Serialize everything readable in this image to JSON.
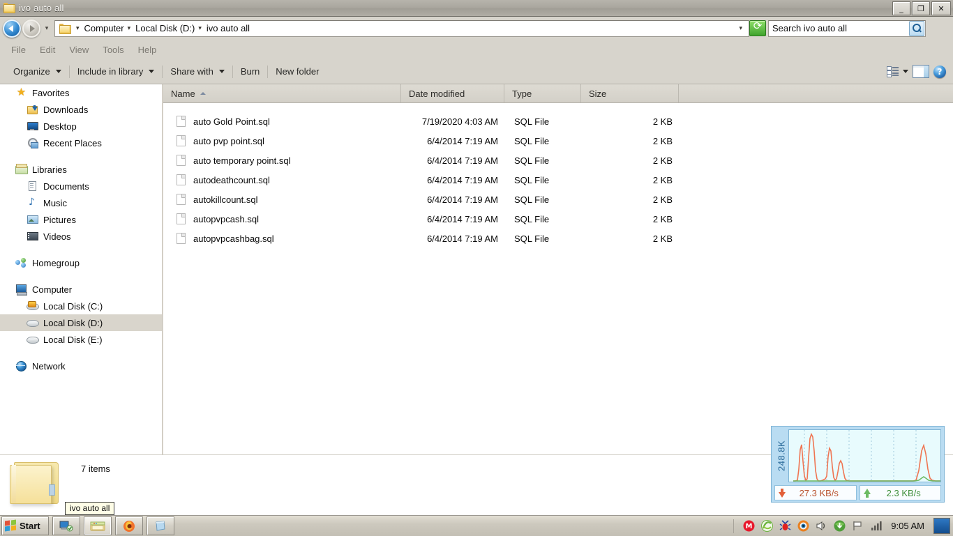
{
  "window": {
    "title": "ivo auto all",
    "icon": "folder-icon",
    "controls": {
      "minimize": "_",
      "maximize": "❐",
      "close": "✕"
    }
  },
  "address_bar": {
    "back_tooltip": "Back",
    "forward_tooltip": "Forward",
    "history_dropdown": "▾",
    "breadcrumbs": [
      "Computer",
      "Local Disk (D:)",
      "ivo auto all"
    ],
    "separator": "▾",
    "dropdown": "▾",
    "refresh_icon": "refresh-icon"
  },
  "search": {
    "value": "Search ivo auto all",
    "placeholder": "Search ivo auto all",
    "button_icon": "search-icon"
  },
  "menubar": {
    "items": [
      "File",
      "Edit",
      "View",
      "Tools",
      "Help"
    ]
  },
  "commandbar": {
    "items": [
      {
        "label": "Organize",
        "has_arrow": true
      },
      {
        "label": "Include in library",
        "has_arrow": true
      },
      {
        "label": "Share with",
        "has_arrow": true
      },
      {
        "label": "Burn",
        "has_arrow": false
      },
      {
        "label": "New folder",
        "has_arrow": false
      }
    ],
    "right": {
      "view_icon": "list-view-icon",
      "view_arrow": "▾",
      "preview_pane_icon": "preview-pane-icon",
      "help_icon": "help-icon",
      "help_glyph": "?"
    }
  },
  "sidebar": {
    "groups": [
      {
        "header": {
          "label": "Favorites",
          "icon": "star-icon"
        },
        "items": [
          {
            "label": "Downloads",
            "icon": "downloads-icon"
          },
          {
            "label": "Desktop",
            "icon": "desktop-icon"
          },
          {
            "label": "Recent Places",
            "icon": "recent-places-icon"
          }
        ]
      },
      {
        "header": {
          "label": "Libraries",
          "icon": "libraries-icon"
        },
        "items": [
          {
            "label": "Documents",
            "icon": "documents-icon"
          },
          {
            "label": "Music",
            "icon": "music-icon"
          },
          {
            "label": "Pictures",
            "icon": "pictures-icon"
          },
          {
            "label": "Videos",
            "icon": "videos-icon"
          }
        ]
      },
      {
        "header": {
          "label": "Homegroup",
          "icon": "homegroup-icon"
        },
        "items": []
      },
      {
        "header": {
          "label": "Computer",
          "icon": "computer-icon"
        },
        "items": [
          {
            "label": "Local Disk (C:)",
            "icon": "system-disk-icon",
            "selected": false
          },
          {
            "label": "Local Disk (D:)",
            "icon": "disk-icon",
            "selected": true
          },
          {
            "label": "Local Disk (E:)",
            "icon": "disk-icon",
            "selected": false
          }
        ]
      },
      {
        "header": {
          "label": "Network",
          "icon": "network-icon"
        },
        "items": []
      }
    ]
  },
  "filelist": {
    "columns": [
      {
        "key": "name",
        "label": "Name",
        "sorted": true,
        "sort_dir": "asc"
      },
      {
        "key": "date",
        "label": "Date modified"
      },
      {
        "key": "type",
        "label": "Type"
      },
      {
        "key": "size",
        "label": "Size"
      }
    ],
    "rows": [
      {
        "name": "auto Gold Point.sql",
        "date": "7/19/2020 4:03 AM",
        "type": "SQL File",
        "size": "2 KB"
      },
      {
        "name": "auto pvp point.sql",
        "date": "6/4/2014 7:19 AM",
        "type": "SQL File",
        "size": "2 KB"
      },
      {
        "name": "auto temporary point.sql",
        "date": "6/4/2014 7:19 AM",
        "type": "SQL File",
        "size": "2 KB"
      },
      {
        "name": "autodeathcount.sql",
        "date": "6/4/2014 7:19 AM",
        "type": "SQL File",
        "size": "2 KB"
      },
      {
        "name": "autokillcount.sql",
        "date": "6/4/2014 7:19 AM",
        "type": "SQL File",
        "size": "2 KB"
      },
      {
        "name": "autopvpcash.sql",
        "date": "6/4/2014 7:19 AM",
        "type": "SQL File",
        "size": "2 KB"
      },
      {
        "name": "autopvpcashbag.sql",
        "date": "6/4/2014 7:19 AM",
        "type": "SQL File",
        "size": "2 KB"
      }
    ]
  },
  "statusbar": {
    "folder_icon": "large-folder-icon",
    "item_count": "7 items"
  },
  "tooltip": {
    "text": "ivo auto all"
  },
  "network_monitor": {
    "peak_label": "248.8K",
    "download": {
      "icon": "download-arrow-icon",
      "value": "27.3 KB/s"
    },
    "upload": {
      "icon": "upload-arrow-icon",
      "value": "2.3 KB/s"
    },
    "graph_color": "#ef7552",
    "background": "#e8fbfd"
  },
  "taskbar": {
    "start": {
      "label": "Start",
      "icon": "windows-logo-icon"
    },
    "buttons": [
      {
        "name": "network-app-icon"
      },
      {
        "name": "explorer-icon",
        "active": true
      },
      {
        "name": "firefox-icon"
      },
      {
        "name": "reader-icon"
      }
    ],
    "tray": [
      {
        "name": "mega-icon",
        "glyph": "M"
      },
      {
        "name": "green-swirl-icon"
      },
      {
        "name": "bug-icon"
      },
      {
        "name": "orange-eye-icon"
      },
      {
        "name": "volume-icon"
      },
      {
        "name": "idm-icon"
      },
      {
        "name": "flag-icon"
      },
      {
        "name": "signal-bars-icon"
      }
    ],
    "clock": "9:05 AM",
    "show_desktop": "show-desktop-button"
  },
  "chart_data": {
    "type": "line",
    "title": "Network throughput",
    "ylabel": "248.8K",
    "series": [
      {
        "name": "download",
        "values": [
          0,
          0,
          0,
          0,
          2,
          38,
          52,
          10,
          4,
          62,
          72,
          60,
          8,
          2,
          0,
          0,
          0,
          34,
          48,
          12,
          2,
          0,
          6,
          22,
          28,
          18,
          4,
          0,
          0,
          0,
          0,
          0,
          0,
          0,
          0,
          0,
          0,
          0,
          0,
          0,
          0,
          0,
          0,
          0,
          0,
          0,
          0,
          0,
          0,
          0,
          0,
          0,
          0,
          0,
          0,
          0,
          0,
          0,
          0,
          0,
          0,
          0,
          0,
          0,
          0,
          0,
          0,
          0,
          0,
          0,
          0,
          0,
          0,
          0,
          0,
          0,
          0,
          0,
          0,
          0,
          0,
          0,
          0,
          0,
          0,
          0,
          0,
          0,
          26,
          50,
          36,
          8,
          2,
          0,
          0,
          0
        ],
        "color": "#ef7552"
      },
      {
        "name": "upload",
        "values": [
          0,
          0,
          0,
          0,
          0,
          0,
          0,
          0,
          0,
          0,
          0,
          0,
          0,
          0,
          0,
          0,
          0,
          0,
          0,
          0,
          0,
          0,
          0,
          0,
          0,
          0,
          0,
          0,
          0,
          0,
          0,
          0,
          0,
          0,
          0,
          0,
          0,
          0,
          0,
          0,
          0,
          0,
          0,
          0,
          0,
          0,
          0,
          0,
          0,
          0,
          0,
          0,
          0,
          0,
          0,
          0,
          0,
          0,
          0,
          0,
          0,
          0,
          0,
          0,
          0,
          0,
          0,
          0,
          0,
          0,
          0,
          0,
          0,
          0,
          0,
          0,
          0,
          0,
          0,
          0,
          0,
          0,
          0,
          0,
          0,
          0,
          0,
          3,
          4,
          3,
          2,
          1,
          0,
          0,
          0,
          0
        ],
        "color": "#6dbb63"
      }
    ],
    "grid": true,
    "ylim": [
      0,
      100
    ]
  }
}
